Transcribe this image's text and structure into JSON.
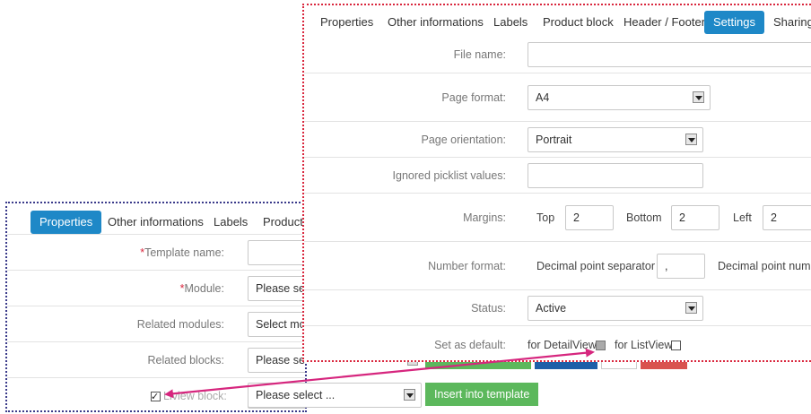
{
  "back_panel": {
    "tabs": [
      "Properties",
      "Other informations",
      "Labels",
      "Product b"
    ],
    "active_tab": "Properties",
    "rows": {
      "template_name": {
        "label": "Template name:",
        "required": "*",
        "value": ""
      },
      "module": {
        "label": "Module:",
        "required": "*",
        "value": "Please se"
      },
      "related_modules": {
        "label": "Related modules:",
        "value": "Select mo"
      },
      "related_blocks": {
        "label": "Related blocks:",
        "value": "Please se"
      },
      "listview_block": {
        "label": "view block:",
        "label_prefix": "Li",
        "value": "Please select ...",
        "insert_button": "Insert into template",
        "checked": true
      }
    }
  },
  "front_panel": {
    "tabs": [
      "Properties",
      "Other informations",
      "Labels",
      "Product block",
      "Header / Footer",
      "Settings",
      "Sharing"
    ],
    "active_tab": "Settings",
    "rows": {
      "file_name": {
        "label": "File name:",
        "value": ""
      },
      "page_format": {
        "label": "Page format:",
        "value": "A4"
      },
      "page_orientation": {
        "label": "Page orientation:",
        "value": "Portrait"
      },
      "ignored_picklist": {
        "label": "Ignored picklist values:",
        "value": ""
      },
      "margins": {
        "label": "Margins:",
        "top_label": "Top",
        "top_value": "2",
        "bottom_label": "Bottom",
        "bottom_value": "2",
        "left_label": "Left",
        "left_value": "2"
      },
      "number_format": {
        "label": "Number format:",
        "decimal_label": "Decimal point separator",
        "decimal_value": ",",
        "decimal_numbe_label": "Decimal point numbe"
      },
      "status": {
        "label": "Status:",
        "value": "Active"
      },
      "set_default": {
        "label": "Set as default:",
        "detail_label": "for DetailView",
        "list_label": "for ListView",
        "detail_checked": false,
        "list_checked": false
      }
    }
  },
  "colors": {
    "active_tab": "#1e88c7",
    "front_border": "#d9263d",
    "back_border": "#3a3a8a",
    "arrow": "#d6267e",
    "green": "#5cb85c",
    "blue": "#1e5fa8",
    "red": "#d9534f"
  }
}
